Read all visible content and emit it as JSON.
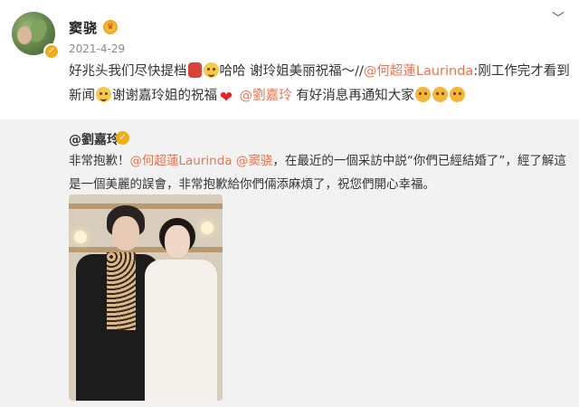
{
  "post": {
    "username": "窦骁",
    "date": "2021-4-29",
    "text": {
      "line1_a": "好兆头我们尽快提档",
      "line1_b": "哈哈 谢玲姐美丽祝福～//",
      "mention1": "@何超蓮Laurinda",
      "line1_c": ":刚工作完才看到",
      "line2_a": "新闻",
      "line2_b": "谢谢嘉玲姐的祝福",
      "mention2": "@劉嘉玲",
      "line2_c": " 有好消息再通知大家"
    },
    "icons": {
      "avatar": "avatar-image",
      "verified": "verified-badge-icon",
      "member": "member-badge-icon",
      "menu": "chevron-down-icon"
    }
  },
  "repost": {
    "author": "@劉嘉玲",
    "text": {
      "a": "非常抱歉！",
      "mention1": "@何超蓮Laurinda",
      "b": " ",
      "mention2": "@窦骁",
      "c": "，在最近的一個采訪中説“你們已經結婚了”，經了解這是一個美麗的誤會，非常抱歉給你們倆添麻煩了，祝您們開心幸福。"
    },
    "photo_alt": "photo-of-two-women"
  },
  "colors": {
    "mention": "#eb7350",
    "repost_bg": "#f2f2f2",
    "verified": "#f0ad19"
  }
}
